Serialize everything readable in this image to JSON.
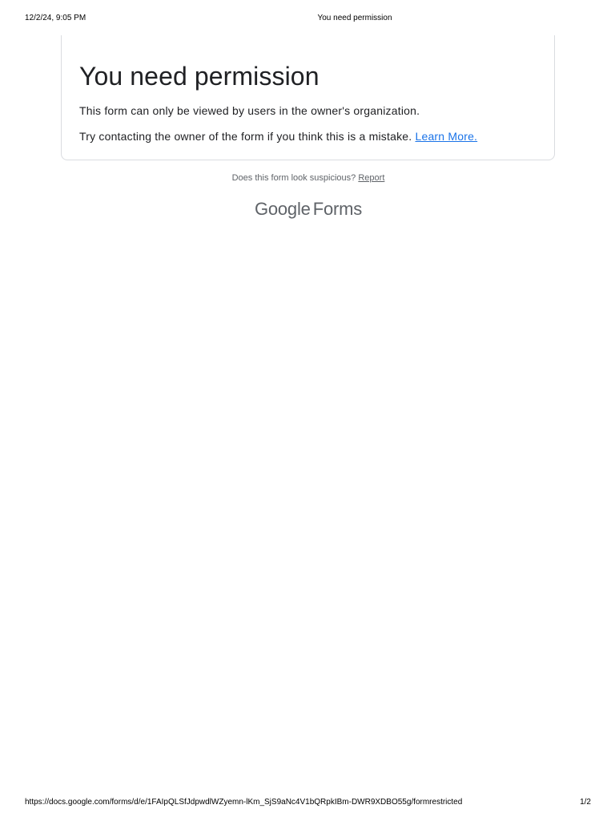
{
  "print_header": {
    "date": "12/2/24, 9:05 PM",
    "title": "You need permission"
  },
  "card": {
    "heading": "You need permission",
    "line1": "This form can only be viewed by users in the owner's organization.",
    "line2_text": "Try contacting the owner of the form if you think this is a mistake.",
    "learn_more": "Learn More."
  },
  "suspicious": {
    "prompt": "Does this form look suspicious?",
    "report": "Report"
  },
  "brand": {
    "google": "Google",
    "forms": "Forms"
  },
  "print_footer": {
    "url": "https://docs.google.com/forms/d/e/1FAIpQLSfJdpwdlWZyemn-lKm_SjS9aNc4V1bQRpkIBm-DWR9XDBO55g/formrestricted",
    "page": "1/2"
  },
  "colors": {
    "link": "#1a73e8",
    "text": "#202124",
    "muted": "#5f6368",
    "border": "#dadce0"
  }
}
